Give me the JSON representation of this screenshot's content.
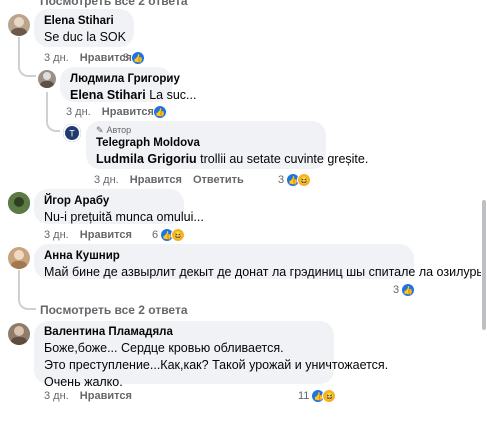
{
  "top_cut_text": "Посмотреть все 2 ответа",
  "comments": [
    {
      "author": "Elena Stihari",
      "text": "Se duc la SOK",
      "time": "3 дн.",
      "like_label": "Нравится",
      "reactions": "8",
      "avatar_color": "#b9a58e"
    },
    {
      "author": "Людмила Григориу",
      "mention": "Elena Stihari",
      "text": " La suc...",
      "time": "3 дн.",
      "like_label": "Нравится",
      "reactions": "",
      "avatar_color": "#9c8f86"
    },
    {
      "badge": "Автор",
      "author": "Telegraph Moldova",
      "mention": "Ludmila Grigoriu",
      "text": " trollii au setate cuvinte greșite.",
      "time": "3 дн.",
      "like_label": "Нравится",
      "reply_label": "Ответить",
      "reactions": "3",
      "avatar_color": "#1f3b70"
    },
    {
      "author": "Йгор Арабу",
      "text": "Nu-i prețuită munca omului...",
      "time": "3 дн.",
      "like_label": "Нравится",
      "reactions": "6",
      "avatar_color": "#4d6a3a"
    },
    {
      "author": "Анна Кушнир",
      "text": "Май бине де азвырлит декыт де донат ла грэдиниц шы спитале ла озилурь.",
      "time": "3 дн.",
      "like_label": "Нравится",
      "reactions": "3",
      "avatar_color": "#c9a27e"
    },
    {
      "author": "Валентина Пламадяла",
      "lines": [
        "Боже,боже... Сердце кровью обливается.",
        "Это преступление...Как,как? Такой урожай и уничтожается.",
        "Очень жалко."
      ],
      "time": "3 дн.",
      "like_label": "Нравится",
      "reactions": "11",
      "avatar_color": "#8e7b6a"
    }
  ],
  "more_replies_label": "Посмотреть все 2 ответа",
  "colors": {
    "bubble": "#f0f2f5",
    "like_blue": "#1b74e4",
    "haha_yellow": "#f7b125",
    "meta_gray": "#65676b"
  }
}
